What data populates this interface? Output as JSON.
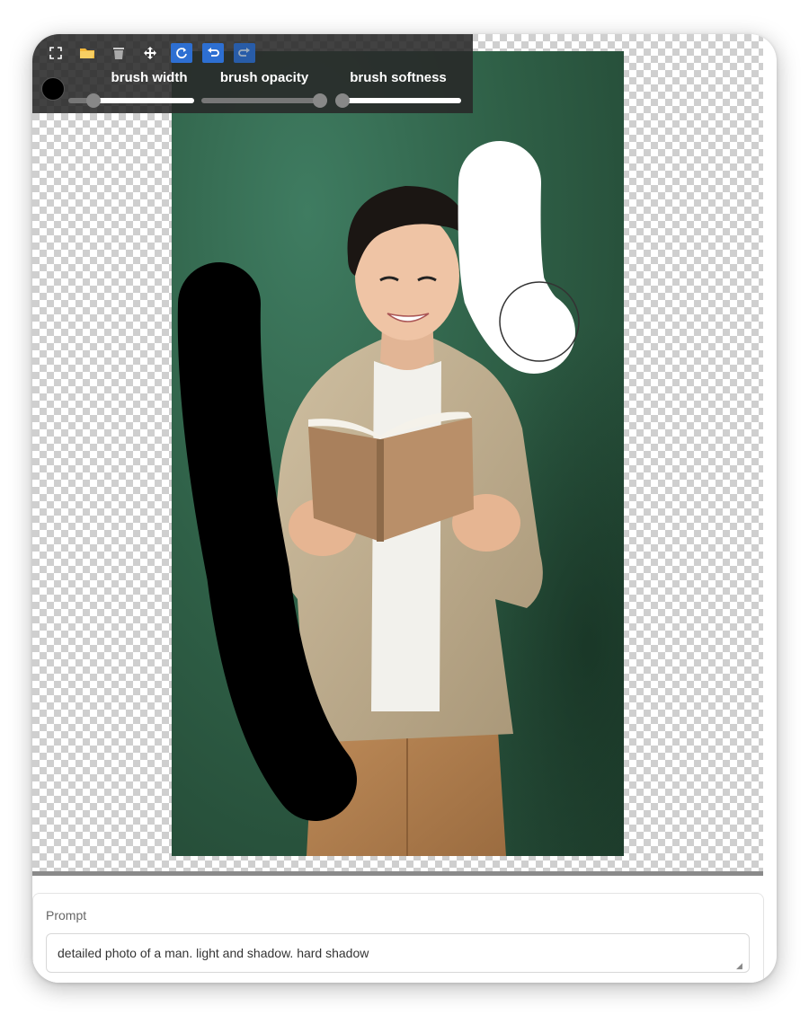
{
  "toolbar": {
    "tools": [
      {
        "icon": "fullscreen-icon",
        "glyph": "⛶"
      },
      {
        "icon": "folder-open-icon",
        "glyph": "📂"
      },
      {
        "icon": "trash-icon",
        "glyph": "🗑"
      },
      {
        "icon": "move-icon",
        "glyph": "✥"
      },
      {
        "icon": "refresh-icon",
        "glyph": "↻"
      },
      {
        "icon": "undo-icon",
        "glyph": "↶"
      },
      {
        "icon": "redo-icon",
        "glyph": "↷"
      }
    ],
    "brush_color": "#000000",
    "sliders": [
      {
        "label": "brush width",
        "value": 0.16
      },
      {
        "label": "brush opacity",
        "value": 1.0
      },
      {
        "label": "brush softness",
        "value": 0.0
      }
    ]
  },
  "prompt": {
    "label": "Prompt",
    "value": "detailed photo of a man. light and shadow. hard shadow"
  },
  "colors": {
    "background_green": "#2f6047",
    "mask_black": "#000000",
    "mask_white": "#ffffff"
  }
}
